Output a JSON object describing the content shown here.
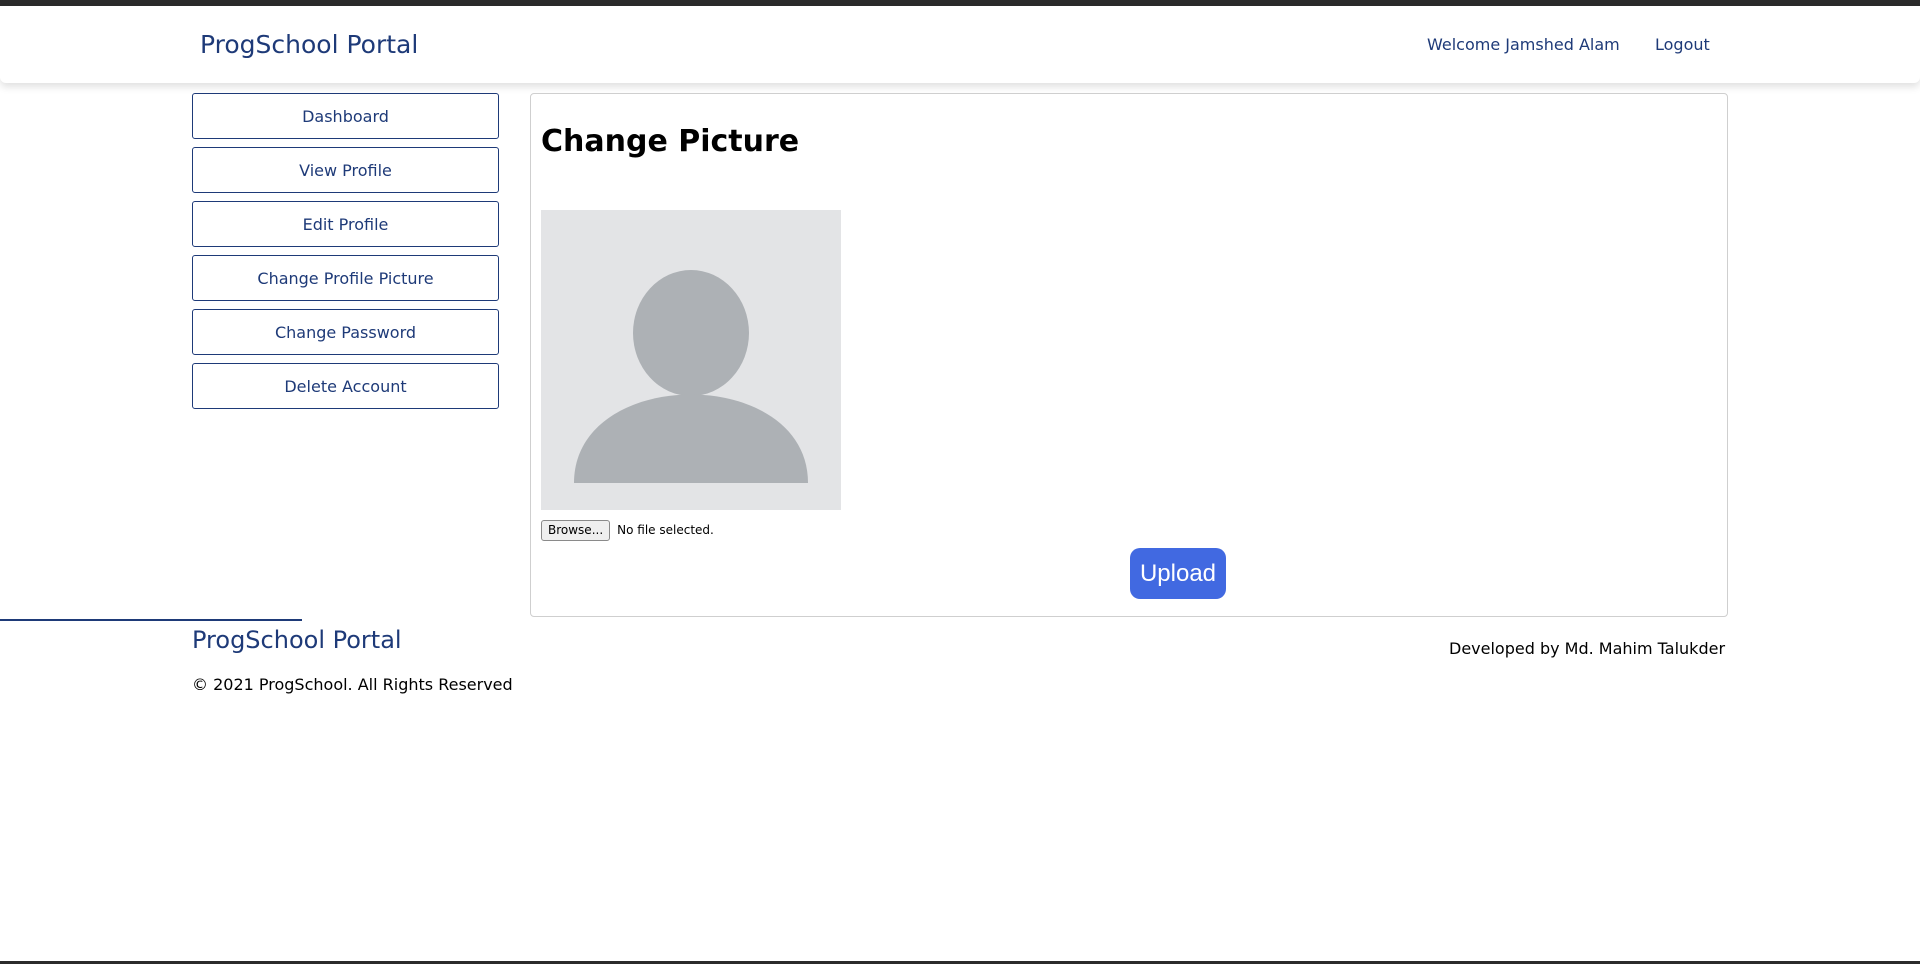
{
  "header": {
    "brand": "ProgSchool Portal",
    "welcome": "Welcome Jamshed Alam",
    "logout": "Logout"
  },
  "sidebar": {
    "items": [
      {
        "label": "Dashboard"
      },
      {
        "label": "View Profile"
      },
      {
        "label": "Edit Profile"
      },
      {
        "label": "Change Profile Picture"
      },
      {
        "label": "Change Password"
      },
      {
        "label": "Delete Account"
      }
    ]
  },
  "main": {
    "title": "Change Picture",
    "avatar_icon": "user-silhouette-icon",
    "file_input": {
      "button_label": "Browse...",
      "status": "No file selected."
    },
    "upload_label": "Upload"
  },
  "footer": {
    "brand": "ProgSchool Portal",
    "copyright": "© 2021 ProgSchool. All Rights Reserved",
    "developer": "Developed by Md. Mahim Talukder"
  },
  "colors": {
    "brand": "#1e3a78",
    "upload_button": "#4169e1",
    "avatar_bg": "#e3e4e6",
    "avatar_figure": "#adb1b5"
  }
}
